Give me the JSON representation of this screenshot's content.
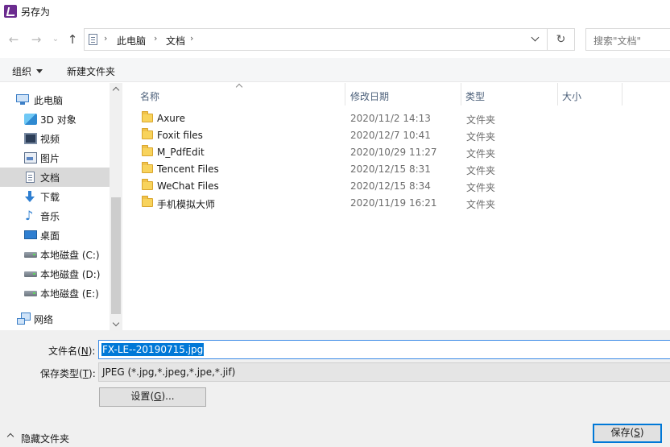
{
  "window": {
    "title": "另存为",
    "brand_color": "#6b2c8f"
  },
  "nav_buttons": {
    "back_icon": "arrow-left-icon",
    "forward_icon": "arrow-right-icon",
    "history_icon": "chevron-down-icon",
    "up_icon": "arrow-up-icon"
  },
  "address": {
    "breadcrumbs": [
      "此电脑",
      "文档"
    ],
    "separator": "›",
    "refresh_symbol": "↻"
  },
  "search": {
    "placeholder": "搜索\"文档\""
  },
  "toolbar": {
    "organize_label": "组织",
    "new_folder_label": "新建文件夹"
  },
  "sidebar": {
    "items": [
      {
        "label": "此电脑",
        "icon": "computer-icon"
      },
      {
        "label": "3D 对象",
        "icon": "3d-objects-icon"
      },
      {
        "label": "视频",
        "icon": "video-icon"
      },
      {
        "label": "图片",
        "icon": "pictures-icon"
      },
      {
        "label": "文档",
        "icon": "documents-icon",
        "selected": true
      },
      {
        "label": "下载",
        "icon": "download-icon"
      },
      {
        "label": "音乐",
        "icon": "music-icon"
      },
      {
        "label": "桌面",
        "icon": "desktop-icon"
      },
      {
        "label": "本地磁盘 (C:)",
        "icon": "drive-icon"
      },
      {
        "label": "本地磁盘 (D:)",
        "icon": "drive-icon"
      },
      {
        "label": "本地磁盘 (E:)",
        "icon": "drive-icon"
      },
      {
        "label": "网络",
        "icon": "network-icon"
      }
    ]
  },
  "file_list": {
    "columns": [
      "名称",
      "修改日期",
      "类型",
      "大小"
    ],
    "rows": [
      {
        "name": "Axure",
        "modified": "2020/11/2 14:13",
        "type": "文件夹"
      },
      {
        "name": "Foxit files",
        "modified": "2020/12/7 10:41",
        "type": "文件夹"
      },
      {
        "name": "M_PdfEdit",
        "modified": "2020/10/29 11:27",
        "type": "文件夹"
      },
      {
        "name": "Tencent Files",
        "modified": "2020/12/15 8:31",
        "type": "文件夹"
      },
      {
        "name": "WeChat Files",
        "modified": "2020/12/15 8:34",
        "type": "文件夹"
      },
      {
        "name": "手机模拟大师",
        "modified": "2020/11/19 16:21",
        "type": "文件夹"
      }
    ]
  },
  "save_form": {
    "filename_label": "文件名",
    "filename_key": "N",
    "filename_value": "FX-LE--20190715.jpg",
    "filetype_label": "保存类型",
    "filetype_key": "T",
    "filetype_value": "JPEG (*.jpg,*.jpeg,*.jpe,*.jif)",
    "settings_label": "设置",
    "settings_key": "G",
    "settings_suffix": "...",
    "hide_folders_label": "隐藏文件夹",
    "save_label": "保存",
    "save_key": "S"
  }
}
